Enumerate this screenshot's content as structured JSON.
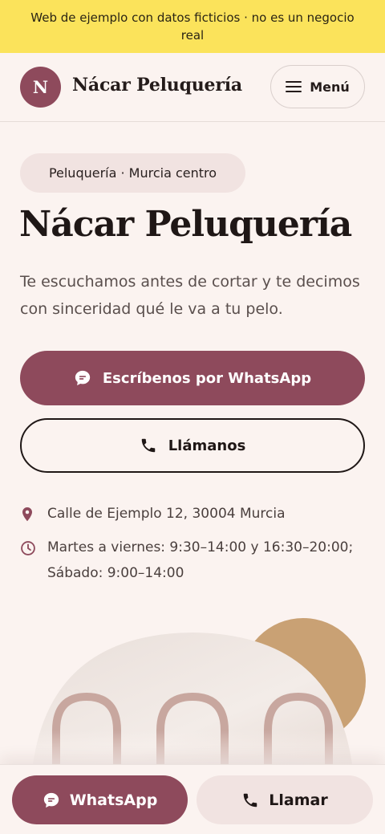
{
  "banner": {
    "text": "Web de ejemplo con datos ficticios · no es un negocio real",
    "color": "#fbe35b"
  },
  "header": {
    "logo_letter": "N",
    "brand_name": "Nácar Peluquería",
    "menu_label": "Menú",
    "menu_icon": "hamburger-icon"
  },
  "hero": {
    "pill": "Peluquería · Murcia centro",
    "title": "Nácar Peluquería",
    "intro": "Te escuchamos antes de cortar y te decimos con sinceridad qué le va a tu pelo.",
    "whatsapp_label": "Escríbenos por WhatsApp",
    "whatsapp_icon": "chat-bubble-icon",
    "call_label": "Llámanos",
    "call_icon": "phone-icon"
  },
  "info": {
    "address": "Calle de Ejemplo 12, 30004 Murcia",
    "address_icon": "location-pin-icon",
    "hours": "Martes a viernes: 9:30–14:00 y 16:30–20:00; Sábado: 9:00–14:00",
    "hours_icon": "clock-icon"
  },
  "bottom_bar": {
    "whatsapp_label": "WhatsApp",
    "call_label": "Llamar"
  },
  "colors": {
    "brand": "#8e4a5c",
    "background": "#fbf3f0",
    "pill": "#f1e3e1",
    "accent_gold": "#c9a174"
  }
}
